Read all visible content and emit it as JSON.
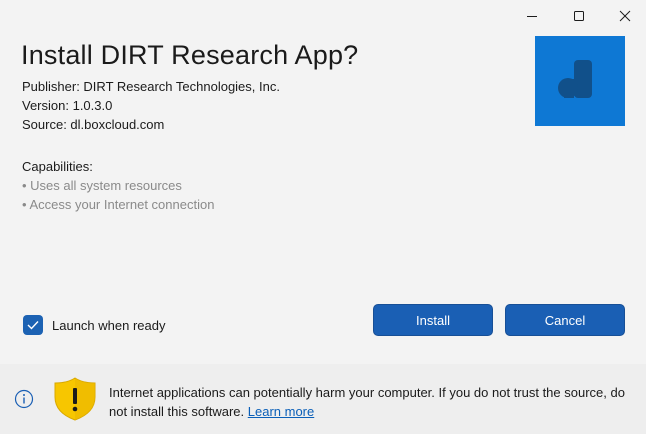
{
  "window": {
    "minimize_icon": "minimize-icon",
    "maximize_icon": "maximize-icon",
    "close_icon": "close-icon"
  },
  "header": {
    "title": "Install DIRT Research App?",
    "publisher": "Publisher: DIRT Research Technologies, Inc.",
    "version": "Version: 1.0.3.0",
    "source": "Source: dl.boxcloud.com"
  },
  "app_tile": {
    "icon": "app-logo-icon",
    "background": "#0e78d4"
  },
  "capabilities": {
    "title": "Capabilities:",
    "items": [
      "• Uses all system resources",
      "• Access your Internet connection"
    ]
  },
  "launch": {
    "label": "Launch when ready",
    "checked": true
  },
  "buttons": {
    "install": "Install",
    "cancel": "Cancel",
    "accent": "#1a5fb4"
  },
  "footer": {
    "info_icon": "info-icon",
    "shield_icon": "warning-shield-icon",
    "warning": "Internet applications can potentially harm your computer. If you do not trust the source, do not install this software.",
    "learn_more": "Learn more"
  }
}
